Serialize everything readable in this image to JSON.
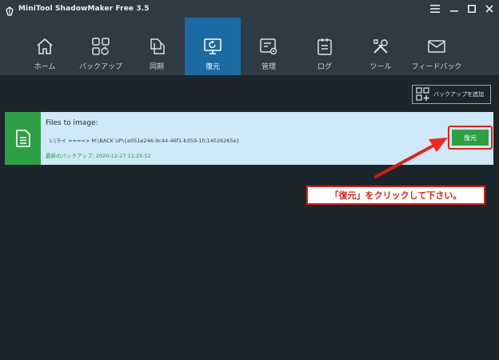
{
  "window": {
    "title": "MiniTool ShadowMaker Free 3.5"
  },
  "nav": {
    "items": [
      {
        "label": "ホーム",
        "icon": "home-icon"
      },
      {
        "label": "バックアップ",
        "icon": "backup-icon"
      },
      {
        "label": "同期",
        "icon": "sync-icon"
      },
      {
        "label": "復元",
        "icon": "restore-icon",
        "active": true
      },
      {
        "label": "管理",
        "icon": "manage-icon"
      },
      {
        "label": "ログ",
        "icon": "log-icon"
      },
      {
        "label": "ツール",
        "icon": "tools-icon"
      },
      {
        "label": "フィードバック",
        "icon": "feedback-icon"
      }
    ]
  },
  "toolbar": {
    "add_backup_label": "バックアップを追加"
  },
  "backup_card": {
    "title": "Files to image:",
    "path": "L:\\ライ ====> M:\\BACK UP\\{e051e246-9c44-46f1-b359-1fc14026265e}",
    "last_backup": "最新のバックアップ: 2020-12-27 11:25:52",
    "restore_label": "復元"
  },
  "annotation": {
    "text": "「復元」をクリックして下さい。"
  },
  "colors": {
    "background": "#1c252b",
    "header": "#2f3b44",
    "active_tab": "#1b6aa3",
    "card": "#cfe9f8",
    "accent_green": "#2f9f46",
    "annotation_red": "#d6211b"
  }
}
